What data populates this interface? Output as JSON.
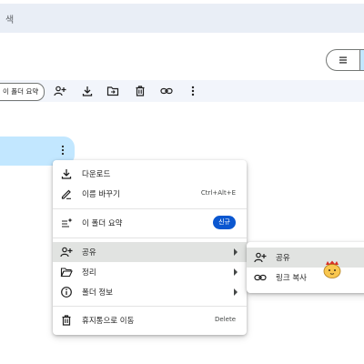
{
  "search": {
    "text": "색"
  },
  "toolbar": {
    "chip_label": "이 폴더 요약"
  },
  "menu": {
    "items": [
      {
        "label": "다운로드",
        "shortcut": ""
      },
      {
        "label": "이름 바꾸기",
        "shortcut": "Ctrl+Alt+E"
      },
      {
        "label": "이 폴더 요약",
        "badge": "신규"
      },
      {
        "label": "공유"
      },
      {
        "label": "정리"
      },
      {
        "label": "폴더 정보"
      },
      {
        "label": "휴지통으로 이동",
        "shortcut": "Delete"
      }
    ]
  },
  "submenu": {
    "items": [
      {
        "label": "공유"
      },
      {
        "label": "링크 복사"
      }
    ]
  },
  "colors": {
    "accent": "#0b57d0",
    "selected_row": "#c2e7ff",
    "hover": "#e1e3e1",
    "searchbar": "#e9eef6"
  }
}
